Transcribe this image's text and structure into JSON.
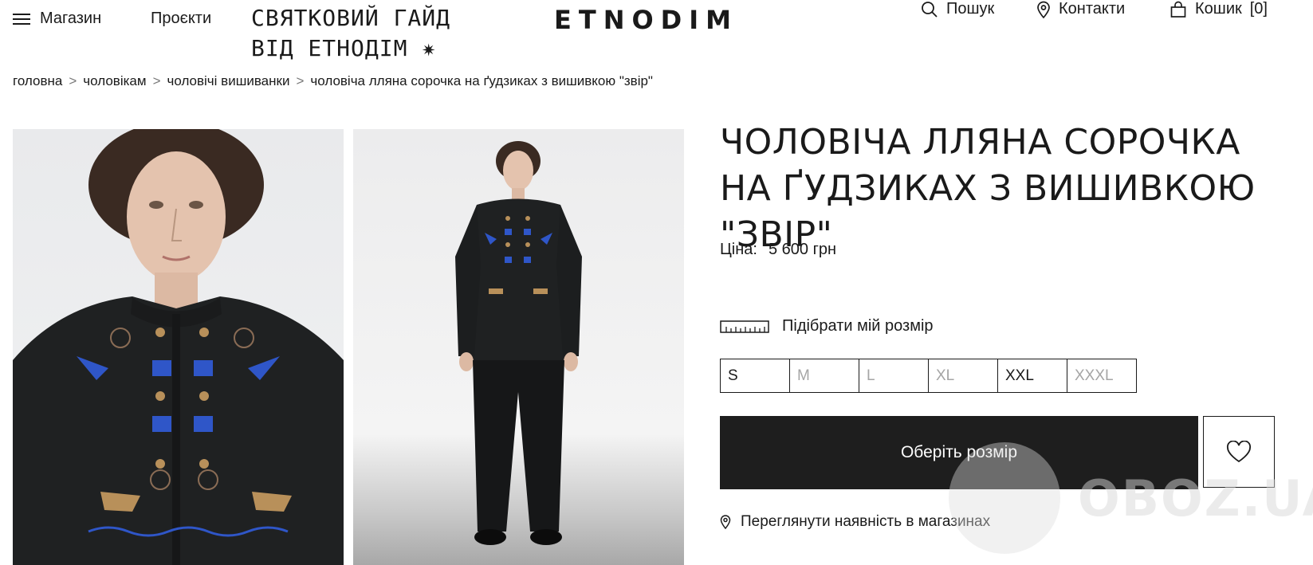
{
  "header": {
    "menu_label": "Магазин",
    "projects_label": "Проєкти",
    "holiday_guide_line1": "СВЯТКОВИЙ ГАЙД",
    "holiday_guide_line2": "ВІД ЕТНОДІМ ✷",
    "logo": "ETNODIM",
    "search_label": "Пошук",
    "contacts_label": "Контакти",
    "cart_label": "Кошик",
    "cart_count": "[0]"
  },
  "breadcrumb": [
    "головна",
    "чоловікам",
    "чоловічі вишиванки",
    "чоловіча лляна сорочка на ґудзиках з вишивкою \"звір\""
  ],
  "breadcrumb_separator": ">",
  "product": {
    "title": "ЧОЛОВІЧА ЛЛЯНА СОРОЧКА НА ҐУДЗИКАХ З ВИШИВКОЮ \"ЗВІР\"",
    "price_label": "Ціна:",
    "price_value": "5 600 грн",
    "size_guide_label": "Підібрати мій розмір",
    "sizes": [
      {
        "label": "S",
        "available": true
      },
      {
        "label": "M",
        "available": false
      },
      {
        "label": "L",
        "available": false
      },
      {
        "label": "XL",
        "available": false
      },
      {
        "label": "XXL",
        "available": true
      },
      {
        "label": "XXXL",
        "available": false
      }
    ],
    "cta_label": "Оберіть розмір",
    "availability_label": "Переглянути наявність в магазинах"
  },
  "watermark": "OBOZ.UA",
  "colors": {
    "text": "#1a1a1a",
    "cta_background": "#1e1e1e",
    "unavailable_size": "#a5a5a5",
    "shirt": "#1f2122",
    "embroidery_blue": "#2f56c8",
    "embroidery_tan": "#b8905a"
  }
}
